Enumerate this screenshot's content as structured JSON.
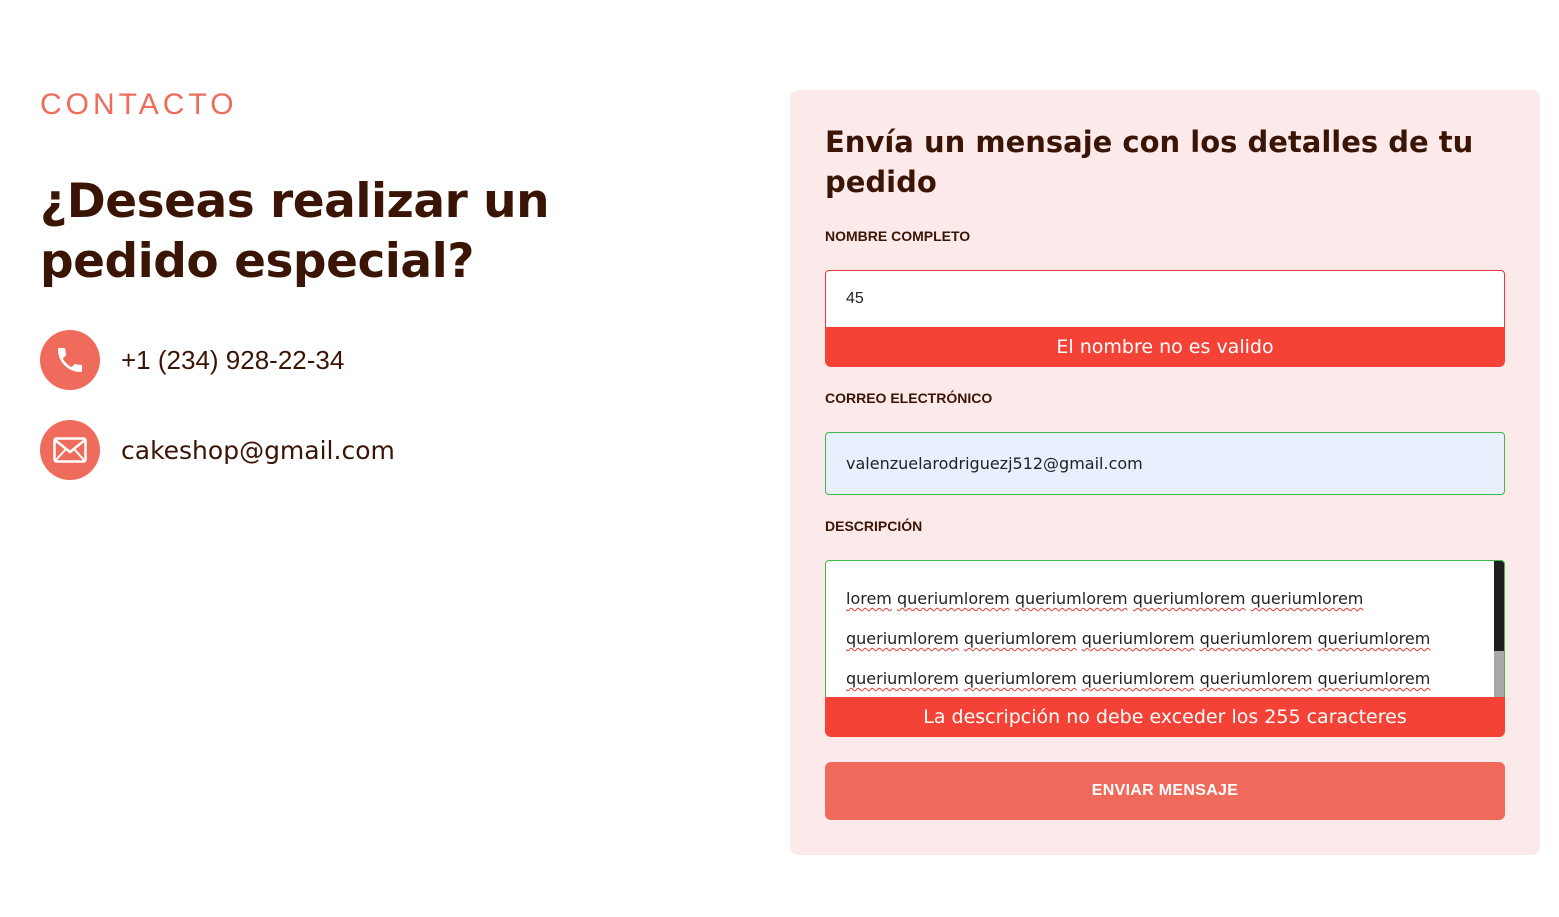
{
  "contact": {
    "eyebrow": "CONTACTO",
    "headline": "¿Deseas realizar un pedido especial?",
    "phone": {
      "icon": "phone-icon",
      "text": "+1 (234) 928-22-34"
    },
    "email": {
      "icon": "mail-icon",
      "text": "cakeshop@gmail.com"
    },
    "accent_color": "#ef6b5b"
  },
  "form": {
    "title": "Envía un mensaje con los detalles de tu pedido",
    "name": {
      "label": "NOMBRE COMPLETO",
      "value": "45",
      "error": "El nombre no es valido"
    },
    "email": {
      "label": "CORREO ELECTRÓNICO",
      "value": "valenzuelarodriguezj512@gmail.com"
    },
    "description": {
      "label": "DESCRIPCIÓN",
      "lines": [
        [
          "lorem",
          "queriumlorem",
          "queriumlorem",
          "queriumlorem",
          "queriumlorem"
        ],
        [
          "queriumlorem",
          "queriumlorem",
          "queriumlorem",
          "queriumlorem",
          "queriumlorem"
        ],
        [
          "queriumlorem",
          "queriumlorem",
          "queriumlorem",
          "queriumlorem",
          "queriumlorem"
        ]
      ],
      "error": "La descripción no debe exceder los 255 caracteres"
    },
    "submit_label": "ENVIAR MENSAJE",
    "error_color": "#f44336",
    "panel_color": "#fce9e9"
  }
}
